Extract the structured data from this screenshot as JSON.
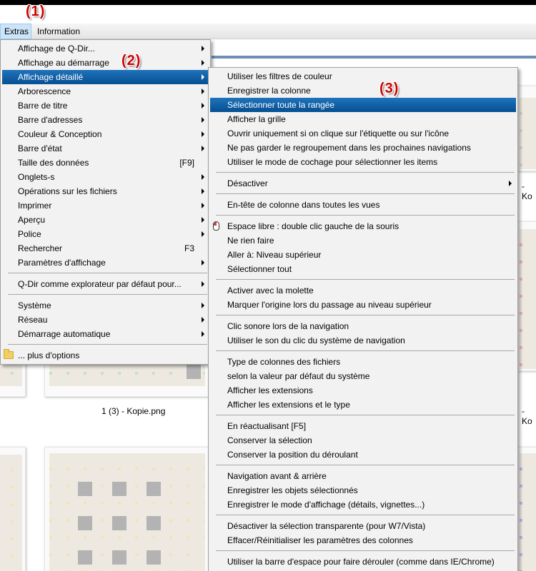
{
  "steps": {
    "s1": "(1)",
    "s2": "(2)",
    "s3": "(3)"
  },
  "menubar": {
    "extras": "Extras",
    "information": "Information"
  },
  "captions": {
    "c1": "1 (3) - Kopie.png",
    "c2": "- Ko",
    "c3": "- Ko"
  },
  "extras_menu": {
    "items": [
      "Affichage de Q-Dir...",
      "Affichage au démarrage",
      "Affichage détaillé",
      "Arborescence",
      "Barre de titre",
      "Barre d'adresses",
      "Couleur & Conception",
      "Barre d'état",
      "Taille des données",
      "Onglets-s",
      "Opérations sur les fichiers",
      "Imprimer",
      "Aperçu",
      "Police",
      "Rechercher",
      "Paramètres d'affichage",
      "Q-Dir comme explorateur par défaut pour...",
      "Système",
      "Réseau",
      "Démarrage automatique",
      "... plus d'options"
    ],
    "shortcuts": {
      "taille": "[F9]",
      "rechercher": "F3"
    }
  },
  "detail_menu": {
    "items": [
      "Utiliser les filtres de couleur",
      "Enregistrer la colonne",
      "Sélectionner toute la rangée",
      "Afficher la grille",
      "Ouvrir uniquement si on clique sur l'étiquette ou sur l'icône",
      "Ne pas garder le regroupement dans les prochaines navigations",
      "Utiliser le mode de cochage pour sélectionner les items",
      "Désactiver",
      "En-tête de colonne dans toutes les vues",
      "Espace libre : double clic gauche de la souris",
      "Ne rien faire",
      "Aller à: Niveau supérieur",
      "Sélectionner tout",
      "Activer avec la molette",
      "Marquer l'origine lors du passage au niveau supérieur",
      "Clic sonore lors de la navigation",
      "Utiliser le son du clic du système de navigation",
      "Type de colonnes des fichiers",
      "selon la valeur par défaut du système",
      "Afficher les extensions",
      "Afficher les extensions et le type",
      "En réactualisant [F5]",
      "Conserver la sélection",
      "Conserver la position du déroulant",
      "Navigation avant & arrière",
      "Enregistrer les objets sélectionnés",
      "Enregistrer le mode d'affichage (détails, vignettes...)",
      "Désactiver la sélection transparente (pour W7/Vista)",
      "Effacer/Réinitialiser les paramètres des colonnes",
      "Utiliser la barre d'espace pour faire dérouler (comme dans IE/Chrome)"
    ]
  }
}
